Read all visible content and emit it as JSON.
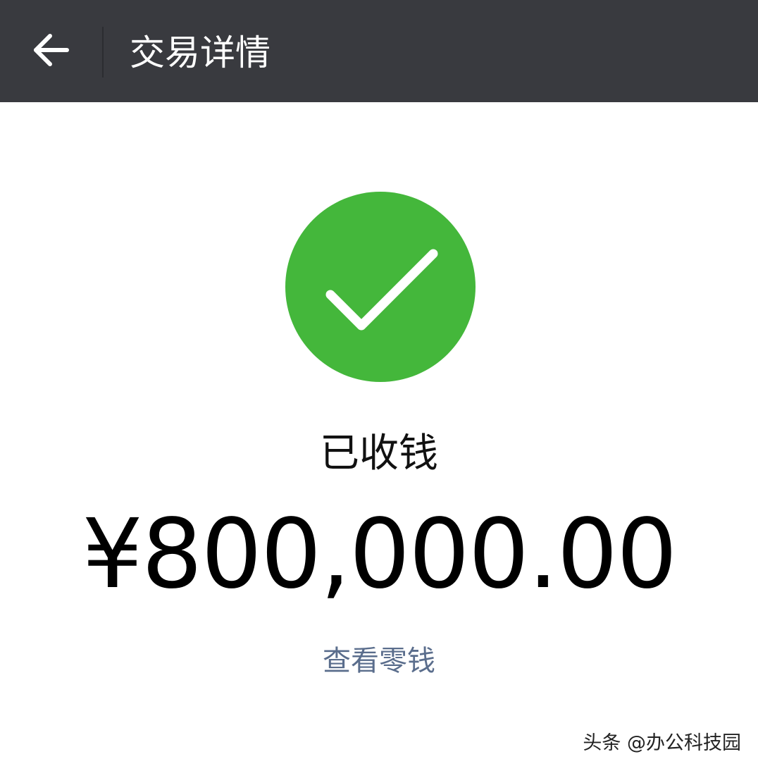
{
  "header": {
    "back_icon": "arrow-left-icon",
    "title": "交易详情",
    "background_color": "#393a3f"
  },
  "status": {
    "icon": "check-circle-icon",
    "icon_color": "#44b73b",
    "text": "已收钱"
  },
  "payment": {
    "amount": "¥800,000.00"
  },
  "actions": {
    "view_change_label": "查看零钱",
    "link_color": "#5a6d8c"
  },
  "watermark": {
    "text": "头条 @办公科技园"
  }
}
